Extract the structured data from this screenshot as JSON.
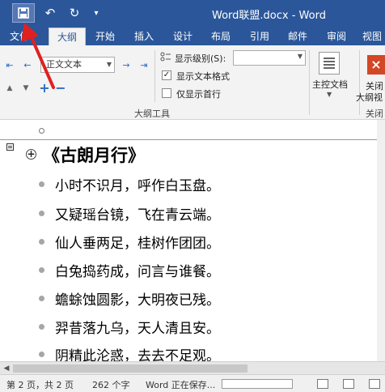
{
  "window": {
    "title": "Word联盟.docx - Word"
  },
  "qat": {
    "save": "save",
    "undo": "↶",
    "redo": "↻",
    "customize": "▾"
  },
  "tabs": [
    {
      "label": "文件"
    },
    {
      "label": "大纲"
    },
    {
      "label": "开始"
    },
    {
      "label": "插入"
    },
    {
      "label": "设计"
    },
    {
      "label": "布局"
    },
    {
      "label": "引用"
    },
    {
      "label": "邮件"
    },
    {
      "label": "审阅"
    },
    {
      "label": "视图"
    }
  ],
  "ribbon": {
    "level_value": "正文文本",
    "show_level_label": "显示级别(S):",
    "show_format_label": "显示文本格式",
    "show_format_checked": true,
    "first_line_only_label": "仅显示首行",
    "first_line_only_checked": false,
    "group_label": "大纲工具",
    "master_doc_label": "主控文档",
    "close_label_1": "关闭",
    "close_label_2": "大纲视",
    "close_group_label": "关闭"
  },
  "icons": {
    "promote_top": "⇤",
    "promote": "←",
    "demote": "→",
    "demote_body": "⇥",
    "move_up": "▲",
    "move_down": "▼",
    "expand": "+",
    "collapse": "−",
    "close_x": "×",
    "plus": "+"
  },
  "document": {
    "heading": "《古朗月行》",
    "lines": [
      "小时不识月，呼作白玉盘。",
      "又疑瑶台镜，飞在青云端。",
      "仙人垂两足，桂树作团团。",
      "白兔捣药成，问言与谁餐。",
      "蟾蜍蚀圆影，大明夜已残。",
      "羿昔落九乌，天人清且安。",
      "阴精此沦惑，去去不足观。"
    ]
  },
  "status": {
    "page": "第 2 页，共 2 页",
    "words": "262 个字",
    "saving": "Word 正在保存..."
  },
  "colors": {
    "title_bar": "#2b579a",
    "ribbon": "#f3f3f3",
    "annotation_arrow": "#e02020"
  }
}
